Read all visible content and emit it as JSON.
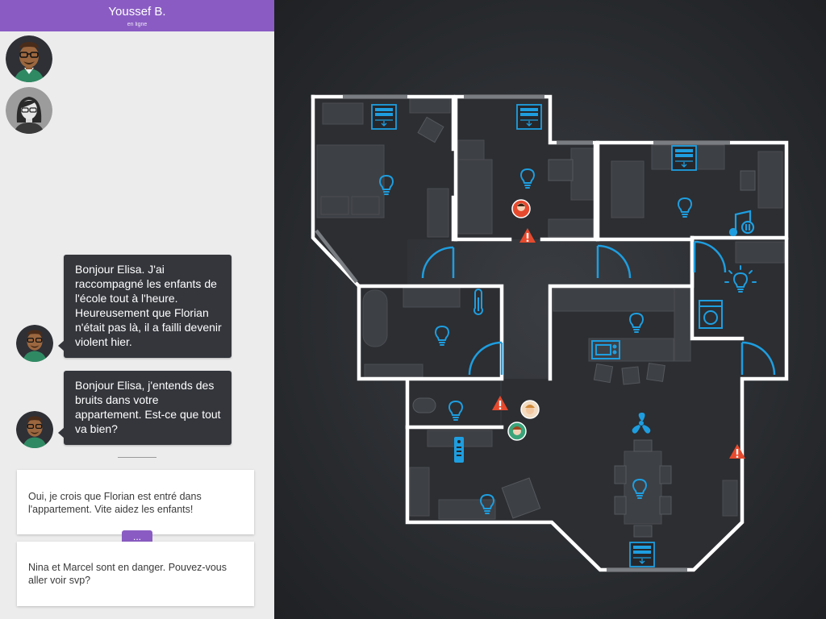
{
  "header": {
    "contact_name": "Youssef B.",
    "contact_status": "en ligne"
  },
  "participants": [
    {
      "avatar": "avatar-youssef",
      "accent": "#2f8a63"
    },
    {
      "avatar": "avatar-elisa",
      "accent": "#8c8c8c"
    }
  ],
  "messages": [
    {
      "from": "Youssef B.",
      "text": "Bonjour Elisa. J'ai raccompagné les enfants de l'école tout à l'heure. Heureusement que Florian n'était pas là, il a failli devenir violent hier."
    },
    {
      "from": "Youssef B.",
      "text": "Bonjour Elisa, j'entends des bruits dans votre appartement. Est-ce que tout va bien?"
    }
  ],
  "reply_options": [
    {
      "text": "Oui, je crois que Florian est entré dans l'appartement. Vite aidez les enfants!"
    },
    {
      "text": "Nina et Marcel sont en danger. Pouvez-vous aller voir svp?"
    }
  ],
  "more_button": {
    "label": "..."
  },
  "floor_plan": {
    "devices": [
      "light-bulb-icon",
      "window-shutter-icon",
      "thermometer-icon",
      "music-speaker-icon",
      "washing-machine-icon",
      "microwave-icon",
      "ceiling-fan-icon",
      "remote-control-icon"
    ],
    "alert_count": 4,
    "colors": {
      "device": "#1e9ee0",
      "alert": "#e64a2e",
      "wall": "#ffffff",
      "accent": "#8a5cc3"
    }
  }
}
